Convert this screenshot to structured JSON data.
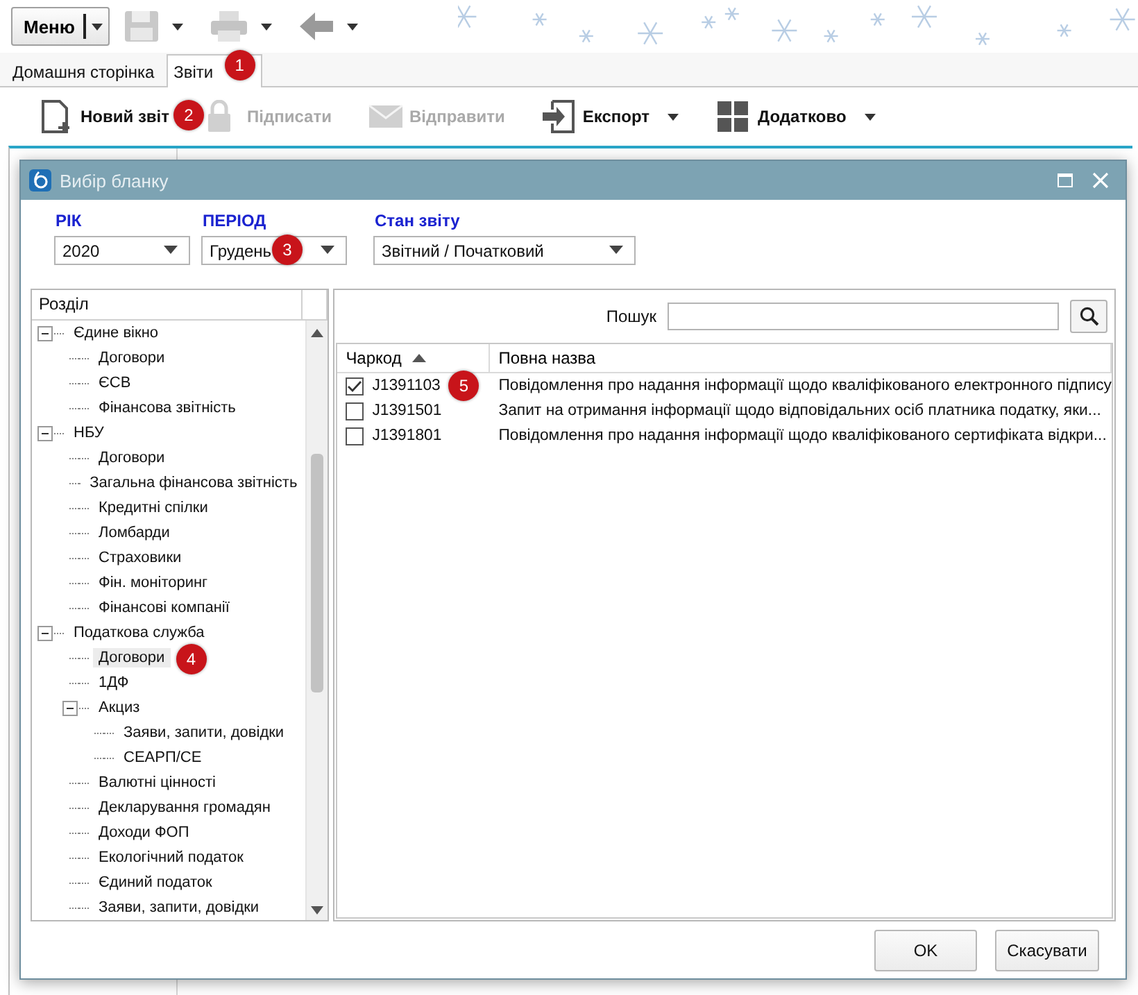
{
  "menu_button": {
    "label": "Меню"
  },
  "tabs": [
    {
      "label": "Домашня сторінка",
      "selected": false
    },
    {
      "label": "Звіти",
      "selected": true,
      "callout": "1"
    }
  ],
  "toolbar": [
    {
      "kind": "new",
      "label": "Новий звіт",
      "disabled": false,
      "dropdown": false,
      "callout": "2"
    },
    {
      "kind": "sign",
      "label": "Підписати",
      "disabled": true,
      "dropdown": false
    },
    {
      "kind": "send",
      "label": "Відправити",
      "disabled": true,
      "dropdown": false
    },
    {
      "kind": "export",
      "label": "Експорт",
      "disabled": false,
      "dropdown": true
    },
    {
      "kind": "more",
      "label": "Додатково",
      "disabled": false,
      "dropdown": true
    }
  ],
  "dialog": {
    "title": "Вибір бланку",
    "filters": [
      {
        "label": "РІК",
        "value": "2020"
      },
      {
        "label": "ПЕРІОД",
        "value": "Грудень",
        "callout": "3"
      },
      {
        "label": "Стан звіту",
        "value": "Звітний / Початковий"
      }
    ],
    "tree": {
      "column": "Розділ",
      "items": [
        {
          "label": "Єдине вікно",
          "selected": false,
          "expanded": true,
          "children": [
            {
              "label": "Договори",
              "selected": false
            },
            {
              "label": "ЄСВ",
              "selected": false
            },
            {
              "label": "Фінансова звітність",
              "selected": false
            }
          ]
        },
        {
          "label": "НБУ",
          "selected": false,
          "expanded": true,
          "children": [
            {
              "label": "Договори",
              "selected": false
            },
            {
              "label": "Загальна фінансова звітність",
              "selected": false
            },
            {
              "label": "Кредитні спілки",
              "selected": false
            },
            {
              "label": "Ломбарди",
              "selected": false
            },
            {
              "label": "Страховики",
              "selected": false
            },
            {
              "label": "Фін. моніторинг",
              "selected": false
            },
            {
              "label": "Фінансові компанії",
              "selected": false
            }
          ]
        },
        {
          "label": "Податкова служба",
          "selected": false,
          "expanded": true,
          "children": [
            {
              "label": "Договори",
              "selected": true,
              "callout": "4"
            },
            {
              "label": "1ДФ",
              "selected": false
            },
            {
              "label": "Акциз",
              "selected": false,
              "expanded": true,
              "children": [
                {
                  "label": "Заяви, запити, довідки",
                  "selected": false
                },
                {
                  "label": "СЕАРП/СЕ",
                  "selected": false
                }
              ]
            },
            {
              "label": "Валютні цінності",
              "selected": false
            },
            {
              "label": "Декларування громадян",
              "selected": false
            },
            {
              "label": "Доходи ФОП",
              "selected": false
            },
            {
              "label": "Екологічний податок",
              "selected": false
            },
            {
              "label": "Єдиний податок",
              "selected": false
            },
            {
              "label": "Заяви, запити, довідки",
              "selected": false
            }
          ]
        }
      ]
    },
    "search": {
      "label": "Пошук"
    },
    "table": {
      "columns": [
        {
          "label": "Чаркод",
          "sorted": true
        },
        {
          "label": "Повна назва",
          "sorted": false
        }
      ],
      "rows": [
        {
          "checked": true,
          "code": "J1391103",
          "name": "Повідомлення про надання інформації щодо кваліфікованого електронного підпису",
          "callout": "5"
        },
        {
          "checked": false,
          "code": "J1391501",
          "name": "Запит на отримання інформації щодо відповідальних осіб платника податку, яки..."
        },
        {
          "checked": false,
          "code": "J1391801",
          "name": "Повідомлення про надання інформації щодо кваліфікованого сертифіката відкри..."
        }
      ]
    },
    "buttons": [
      "OK",
      "Скасувати"
    ]
  }
}
